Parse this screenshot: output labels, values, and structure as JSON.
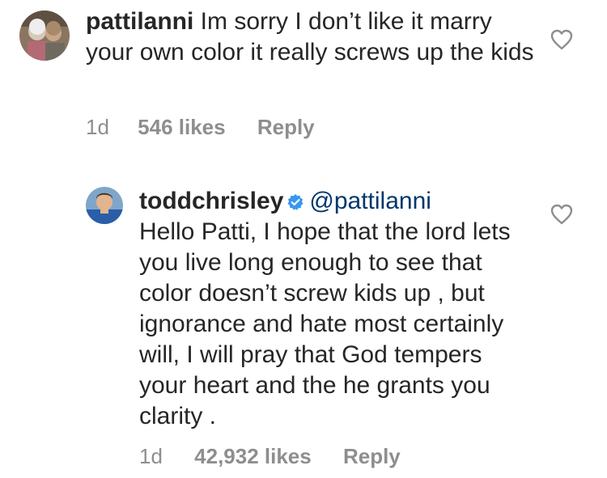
{
  "comments": [
    {
      "username": "pattilanni",
      "text": " Im sorry I don’t like it marry your own color it really screws up the kids",
      "time": "1d",
      "likes": "546 likes",
      "reply_label": "Reply"
    },
    {
      "username": "toddchrisley",
      "mention": "@pattilanni",
      "text": "Hello Patti, I hope that the lord lets you live long enough to see that color doesn’t screw kids up , but ignorance and hate most certainly will, I will pray that God tempers your heart and the he grants you clarity .",
      "time": "1d",
      "likes": "42,932 likes",
      "reply_label": "Reply"
    }
  ],
  "colors": {
    "text": "#262626",
    "meta": "#8e8e8e",
    "verified": "#3897f0",
    "mention": "#00376b"
  },
  "icons": [
    "heart-outline-icon",
    "verified-badge-icon"
  ]
}
